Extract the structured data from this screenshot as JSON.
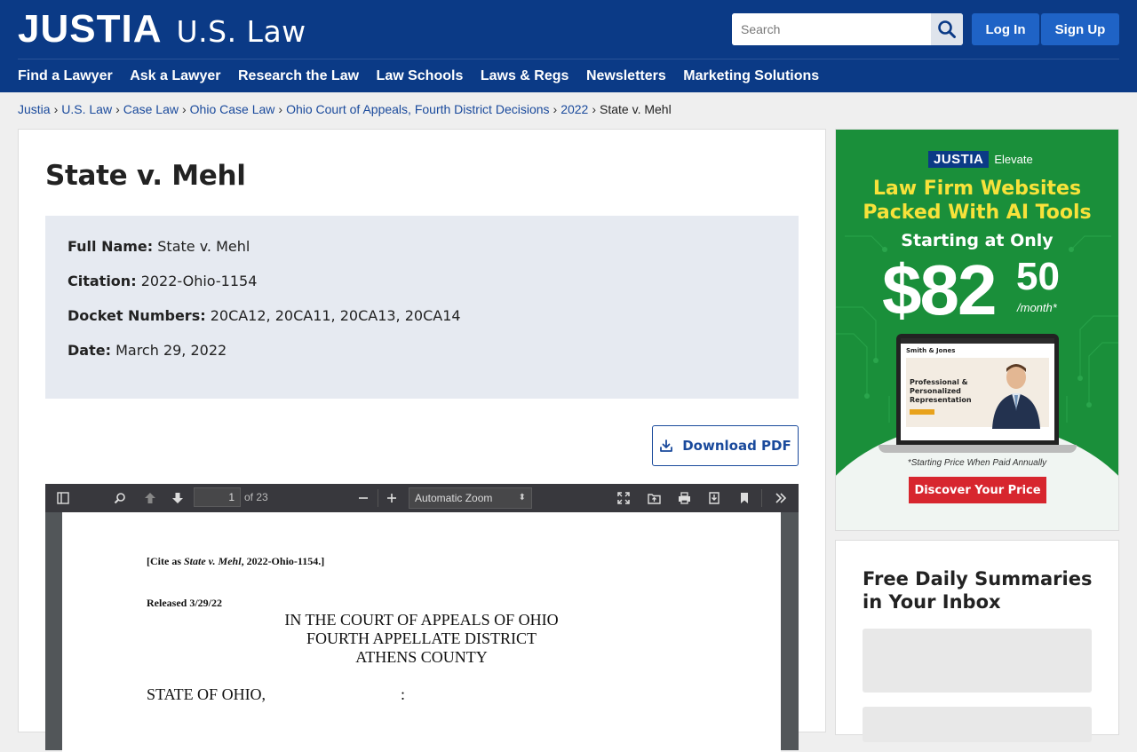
{
  "header": {
    "logo_main": "JUSTIA",
    "logo_sub": "U.S. Law",
    "search_placeholder": "Search",
    "login_label": "Log In",
    "signup_label": "Sign Up",
    "nav": [
      "Find a Lawyer",
      "Ask a Lawyer",
      "Research the Law",
      "Law Schools",
      "Laws & Regs",
      "Newsletters",
      "Marketing Solutions"
    ]
  },
  "breadcrumb": {
    "links": [
      "Justia",
      "U.S. Law",
      "Case Law",
      "Ohio Case Law",
      "Ohio Court of Appeals, Fourth District Decisions",
      "2022"
    ],
    "current": "State v. Mehl",
    "separator": "›"
  },
  "case": {
    "title": "State v. Mehl",
    "fields": [
      {
        "label": "Full Name:",
        "value": "State v. Mehl"
      },
      {
        "label": "Citation:",
        "value": "2022-Ohio-1154"
      },
      {
        "label": "Docket Numbers:",
        "value": "20CA12, 20CA11, 20CA13, 20CA14"
      },
      {
        "label": "Date:",
        "value": "March 29, 2022"
      }
    ],
    "download_label": "Download PDF"
  },
  "pdf": {
    "page_current": "1",
    "page_total": "of 23",
    "zoom": "Automatic Zoom",
    "cite_prefix": "[Cite as ",
    "cite_italic": "State v. Mehl",
    "cite_suffix": ", 2022-Ohio-1154.]",
    "released": "Released 3/29/22",
    "court_line1": "IN THE COURT OF APPEALS OF OHIO",
    "court_line2": "FOURTH APPELLATE DISTRICT",
    "court_line3": "ATHENS COUNTY",
    "party": "STATE OF OHIO,",
    "colon": ":"
  },
  "ad": {
    "brand_box": "JUSTIA",
    "brand_text": "Elevate",
    "headline_1": "Law Firm Websites",
    "headline_2": "Packed With AI Tools",
    "starting": "Starting at Only",
    "price": "$82",
    "cents": "50",
    "per": "/month*",
    "firm_name": "Smith & Jones",
    "firm_tagline_1": "Professional &",
    "firm_tagline_2": "Personalized",
    "firm_tagline_3": "Representation",
    "note": "*Starting Price When Paid Annually",
    "cta": "Discover Your Price"
  },
  "newsletter": {
    "title": "Free Daily Summaries in Your Inbox"
  },
  "colors": {
    "header_bg": "#0b3a86",
    "button_blue": "#1f63c6",
    "link_blue": "#1a4a9c",
    "ad_green": "#1a8f3a",
    "ad_yellow": "#f7e23a",
    "cta_red": "#d7262e"
  }
}
